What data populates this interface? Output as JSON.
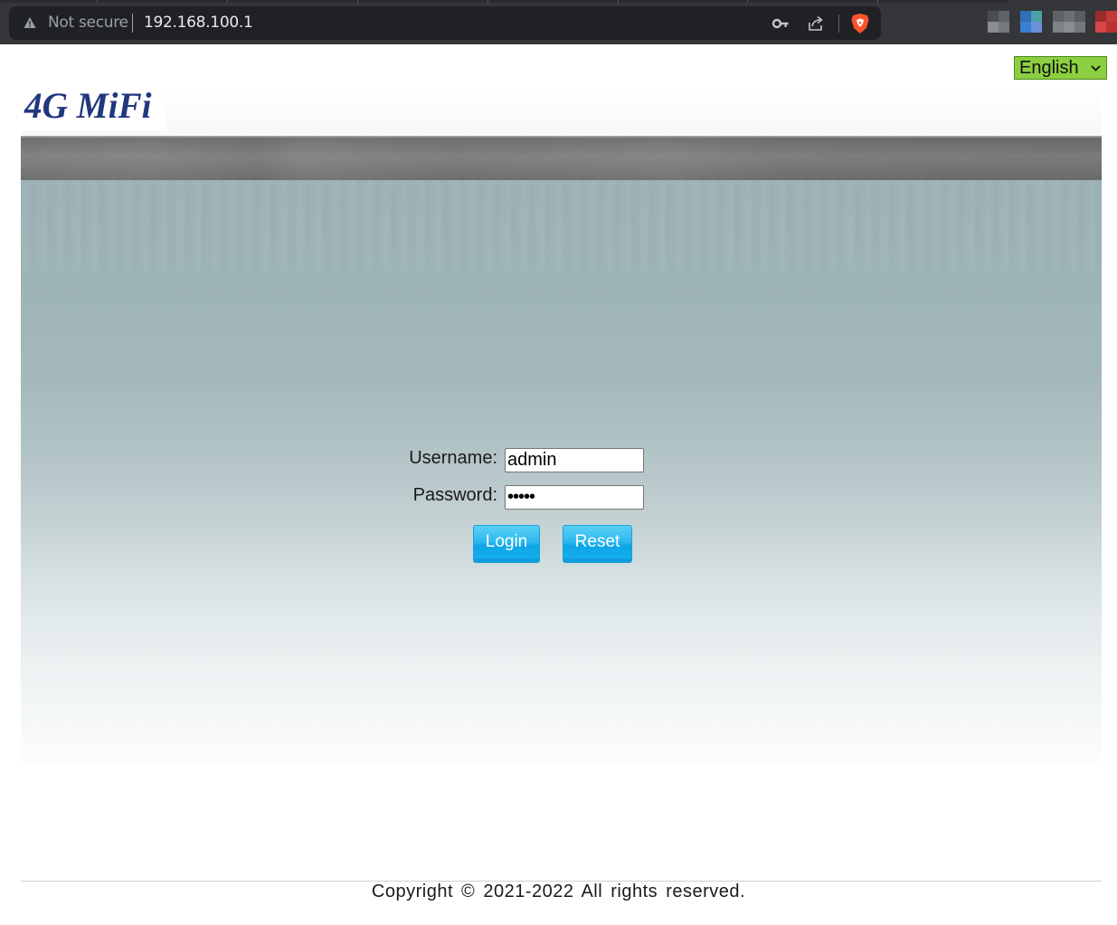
{
  "browser": {
    "security_label": "Not secure",
    "url": "192.168.100.1",
    "icons": [
      "warning-icon",
      "key-icon",
      "share-icon",
      "brave-shield-icon"
    ],
    "extensions": [
      "extension-icon-1",
      "extension-icon-2",
      "extension-icon-3",
      "extension-icon-4"
    ]
  },
  "header": {
    "logo_text": "4G MiFi",
    "language": {
      "selected": "English",
      "accent_color": "#8ccf40"
    }
  },
  "login_form": {
    "username_label": "Username:",
    "username_value": "admin",
    "password_label": "Password:",
    "password_value": "•••••",
    "login_button": "Login",
    "reset_button": "Reset",
    "button_color": "#2bb8ef"
  },
  "footer": {
    "copyright": "Copyright © 2021-2022 All rights reserved."
  }
}
